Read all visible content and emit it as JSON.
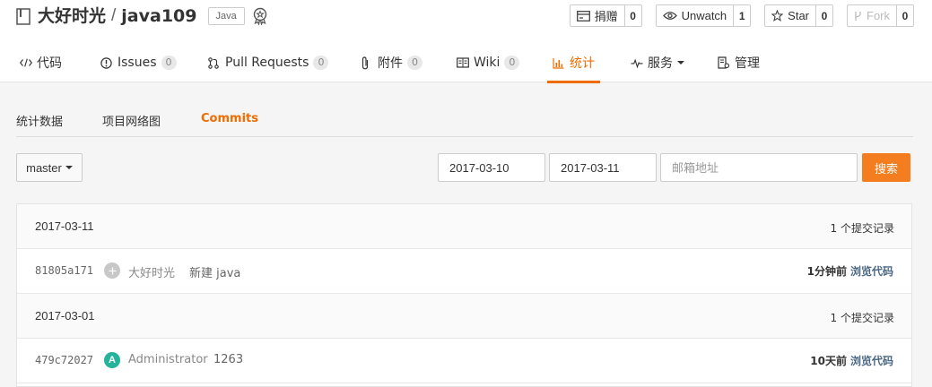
{
  "repo": {
    "owner": "大好时光",
    "separator": "/",
    "name": "java109",
    "language": "Java"
  },
  "actions": [
    {
      "label": "捐赠",
      "count": "0",
      "icon": "wallet-icon"
    },
    {
      "label": "Unwatch",
      "count": "1",
      "icon": "eye-icon"
    },
    {
      "label": "Star",
      "count": "0",
      "icon": "star-icon"
    },
    {
      "label": "Fork",
      "count": "0",
      "icon": "fork-icon"
    }
  ],
  "nav": [
    {
      "label": "代码",
      "icon": "code-icon"
    },
    {
      "label": "Issues",
      "count": "0",
      "icon": "info-icon"
    },
    {
      "label": "Pull Requests",
      "count": "0",
      "icon": "pull-request-icon"
    },
    {
      "label": "附件",
      "count": "0",
      "icon": "paperclip-icon"
    },
    {
      "label": "Wiki",
      "count": "0",
      "icon": "book-icon"
    },
    {
      "label": "统计",
      "icon": "bar-chart-icon"
    },
    {
      "label": "服务",
      "icon": "pulse-icon"
    },
    {
      "label": "管理",
      "icon": "settings-doc-icon"
    }
  ],
  "subtabs": [
    "统计数据",
    "项目网络图",
    "Commits"
  ],
  "filter": {
    "branch": "master",
    "start_date": "2017-03-10",
    "end_date": "2017-03-11",
    "email_placeholder": "邮箱地址",
    "search_label": "搜索"
  },
  "days": [
    {
      "date": "2017-03-11",
      "count_label": "1 个提交记录",
      "commit": {
        "sha": "81805a171",
        "avatar_letter": "",
        "author": "大好时光",
        "message": "新建 java",
        "time": "1分钟前",
        "browse_label": "浏览代码"
      }
    },
    {
      "date": "2017-03-01",
      "count_label": "1 个提交记录",
      "commit": {
        "sha": "479c72027",
        "avatar_letter": "A",
        "author": "Administrator",
        "message": "1263",
        "time": "10天前",
        "browse_label": "浏览代码"
      }
    }
  ],
  "colors": {
    "accent": "#ef6c00",
    "search_button": "#f47d20",
    "avatar_default": "#c8c8c8",
    "avatar_admin": "#26b39b",
    "browse_link": "#4a6785"
  }
}
